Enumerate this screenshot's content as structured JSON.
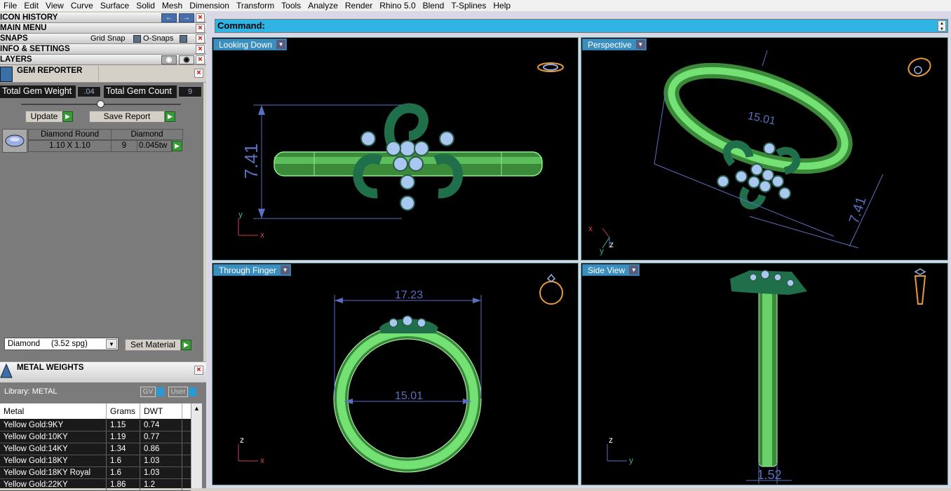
{
  "menu": [
    "File",
    "Edit",
    "View",
    "Curve",
    "Surface",
    "Solid",
    "Mesh",
    "Dimension",
    "Transform",
    "Tools",
    "Analyze",
    "Render",
    "Rhino 5.0",
    "Blend",
    "T-Splines",
    "Help"
  ],
  "left": {
    "headers": {
      "icon_history": "ICON HISTORY",
      "main_menu": "MAIN MENU",
      "snaps": "SNAPS",
      "info": "INFO & SETTINGS",
      "layers": "LAYERS"
    },
    "snaps": {
      "grid_snap": "Grid Snap",
      "osnaps": "O-Snaps"
    },
    "gem_reporter": {
      "title": "GEM REPORTER",
      "total_weight_label": "Total Gem Weight",
      "total_weight": ".04",
      "total_count_label": "Total Gem Count",
      "total_count": "9",
      "update": "Update",
      "save_report": "Save Report",
      "row": {
        "shape": "Diamond Round",
        "material": "Diamond",
        "size": "1.10 X 1.10",
        "count": "9",
        "weight": "0.045tw"
      },
      "material_select": "Diamond     (3.52 spg)",
      "set_material": "Set Material"
    },
    "metal_weights": {
      "title": "METAL WEIGHTS",
      "library": "Library: METAL",
      "gv": "GV",
      "user": "User",
      "columns": [
        "Metal",
        "Grams",
        "DWT"
      ],
      "rows": [
        {
          "metal": "Yellow Gold:9KY",
          "grams": "1.15",
          "dwt": "0.74"
        },
        {
          "metal": "Yellow Gold:10KY",
          "grams": "1.19",
          "dwt": "0.77"
        },
        {
          "metal": "Yellow Gold:14KY",
          "grams": "1.34",
          "dwt": "0.86"
        },
        {
          "metal": "Yellow Gold:18KY",
          "grams": "1.6",
          "dwt": "1.03"
        },
        {
          "metal": "Yellow Gold:18KY Royal",
          "grams": "1.6",
          "dwt": "1.03"
        },
        {
          "metal": "Yellow Gold:22KY",
          "grams": "1.86",
          "dwt": "1.2"
        }
      ]
    }
  },
  "command": {
    "label": "Command:"
  },
  "viewports": {
    "top_left": {
      "title": "Looking Down",
      "dim": "7.41",
      "ax1": "y",
      "ax2": "x"
    },
    "top_right": {
      "title": "Perspective",
      "dim1": "15.01",
      "dim2": "7.41",
      "ax1": "x",
      "ax2": "z",
      "ax3": "y"
    },
    "bottom_left": {
      "title": "Through Finger",
      "dim1": "17.23",
      "dim2": "15.01",
      "ax1": "z",
      "ax2": "x"
    },
    "bottom_right": {
      "title": "Side View",
      "dim": "1.52",
      "ax1": "z",
      "ax2": "y"
    }
  },
  "colors": {
    "ring": "#7ef07e",
    "gem": "#a8c8f0",
    "setting": "#1f6f4a",
    "dimension": "#5a6fc0",
    "accent": "#2fb4e4"
  }
}
